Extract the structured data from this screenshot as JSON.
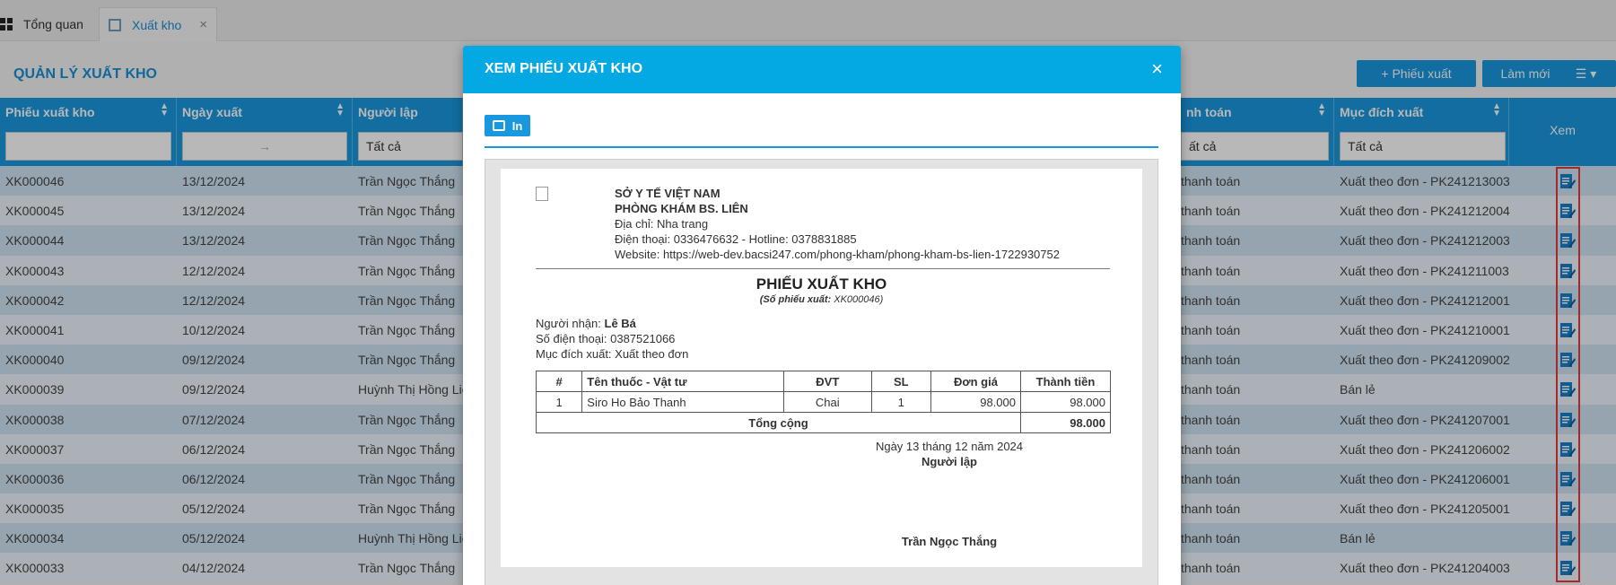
{
  "tabs": {
    "home": "Tổng quan",
    "active": "Xuất kho",
    "close": "×"
  },
  "page": {
    "title": "QUẢN LÝ XUẤT KHO",
    "add_button": "+ Phiếu xuất",
    "refresh_button": "Làm mới",
    "menu_button": "☰ ▾"
  },
  "grid": {
    "columns": {
      "code": "Phiếu xuất kho",
      "date": "Ngày xuất",
      "creator": "Người lập",
      "payment": "nh toán",
      "purpose": "Mục đích xuất",
      "view": "Xem"
    },
    "filters": {
      "date_arrow": "→",
      "creator": "Tất cả",
      "payment": "ất cả",
      "purpose": "Tất cả"
    },
    "rows": [
      {
        "code": "XK000046",
        "date": "13/12/2024",
        "creator": "Trần Ngọc Thắng",
        "payment": "thanh toán",
        "purpose": "Xuất theo đơn - PK241213003"
      },
      {
        "code": "XK000045",
        "date": "13/12/2024",
        "creator": "Trần Ngọc Thắng",
        "payment": "thanh toán",
        "purpose": "Xuất theo đơn - PK241212004"
      },
      {
        "code": "XK000044",
        "date": "13/12/2024",
        "creator": "Trần Ngọc Thắng",
        "payment": "thanh toán",
        "purpose": "Xuất theo đơn - PK241212003"
      },
      {
        "code": "XK000043",
        "date": "12/12/2024",
        "creator": "Trần Ngọc Thắng",
        "payment": "thanh toán",
        "purpose": "Xuất theo đơn - PK241211003"
      },
      {
        "code": "XK000042",
        "date": "12/12/2024",
        "creator": "Trần Ngọc Thắng",
        "payment": "thanh toán",
        "purpose": "Xuất theo đơn - PK241212001"
      },
      {
        "code": "XK000041",
        "date": "10/12/2024",
        "creator": "Trần Ngọc Thắng",
        "payment": "thanh toán",
        "purpose": "Xuất theo đơn - PK241210001"
      },
      {
        "code": "XK000040",
        "date": "09/12/2024",
        "creator": "Trần Ngọc Thắng",
        "payment": "thanh toán",
        "purpose": "Xuất theo đơn - PK241209002"
      },
      {
        "code": "XK000039",
        "date": "09/12/2024",
        "creator": "Huỳnh Thị Hồng Liê",
        "payment": "thanh toán",
        "purpose": "Bán lẻ"
      },
      {
        "code": "XK000038",
        "date": "07/12/2024",
        "creator": "Trần Ngọc Thắng",
        "payment": "thanh toán",
        "purpose": "Xuất theo đơn - PK241207001"
      },
      {
        "code": "XK000037",
        "date": "06/12/2024",
        "creator": "Trần Ngọc Thắng",
        "payment": "thanh toán",
        "purpose": "Xuất theo đơn - PK241206002"
      },
      {
        "code": "XK000036",
        "date": "06/12/2024",
        "creator": "Trần Ngọc Thắng",
        "payment": "thanh toán",
        "purpose": "Xuất theo đơn - PK241206001"
      },
      {
        "code": "XK000035",
        "date": "05/12/2024",
        "creator": "Trần Ngọc Thắng",
        "payment": "thanh toán",
        "purpose": "Xuất theo đơn - PK241205001"
      },
      {
        "code": "XK000034",
        "date": "05/12/2024",
        "creator": "Huỳnh Thị Hồng Liê",
        "payment": "thanh toán",
        "purpose": "Bán lẻ"
      },
      {
        "code": "XK000033",
        "date": "04/12/2024",
        "creator": "Trần Ngọc Thắng",
        "payment": "thanh toán",
        "purpose": "Xuất theo đơn - PK241204003"
      }
    ]
  },
  "modal": {
    "title": "XEM PHIẾU XUẤT KHO",
    "close": "×",
    "print_button": "In",
    "clinic": {
      "dept": "SỞ Y TẾ VIỆT NAM",
      "name": "PHÒNG KHÁM BS. LIÊN",
      "address": "Địa chỉ: Nha trang",
      "phone": "Điện thoại: 0336476632 - Hotline: 0378831885",
      "website": "Website: https://web-dev.bacsi247.com/phong-kham/phong-kham-bs-lien-1722930752"
    },
    "doc_title": "PHIẾU XUẤT KHO",
    "doc_number_label": "(Số phiếu xuất:",
    "doc_number": "XK000046)",
    "receiver_label": "Người nhận:",
    "receiver": "Lê Bá",
    "phone_line": "Số điện thoại: 0387521066",
    "purpose_line": "Mục đích xuất: Xuất theo đơn",
    "table": {
      "headers": [
        "#",
        "Tên thuốc - Vật tư",
        "ĐVT",
        "SL",
        "Đơn giá",
        "Thành tiền"
      ],
      "row": [
        "1",
        "Siro Ho Bảo Thanh",
        "Chai",
        "1",
        "98.000",
        "98.000"
      ],
      "total_label": "Tổng cộng",
      "total_value": "98.000"
    },
    "sign_date": "Ngày 13 tháng 12 năm 2024",
    "sign_role": "Người lập",
    "sign_name": "Trần Ngọc Thắng"
  }
}
